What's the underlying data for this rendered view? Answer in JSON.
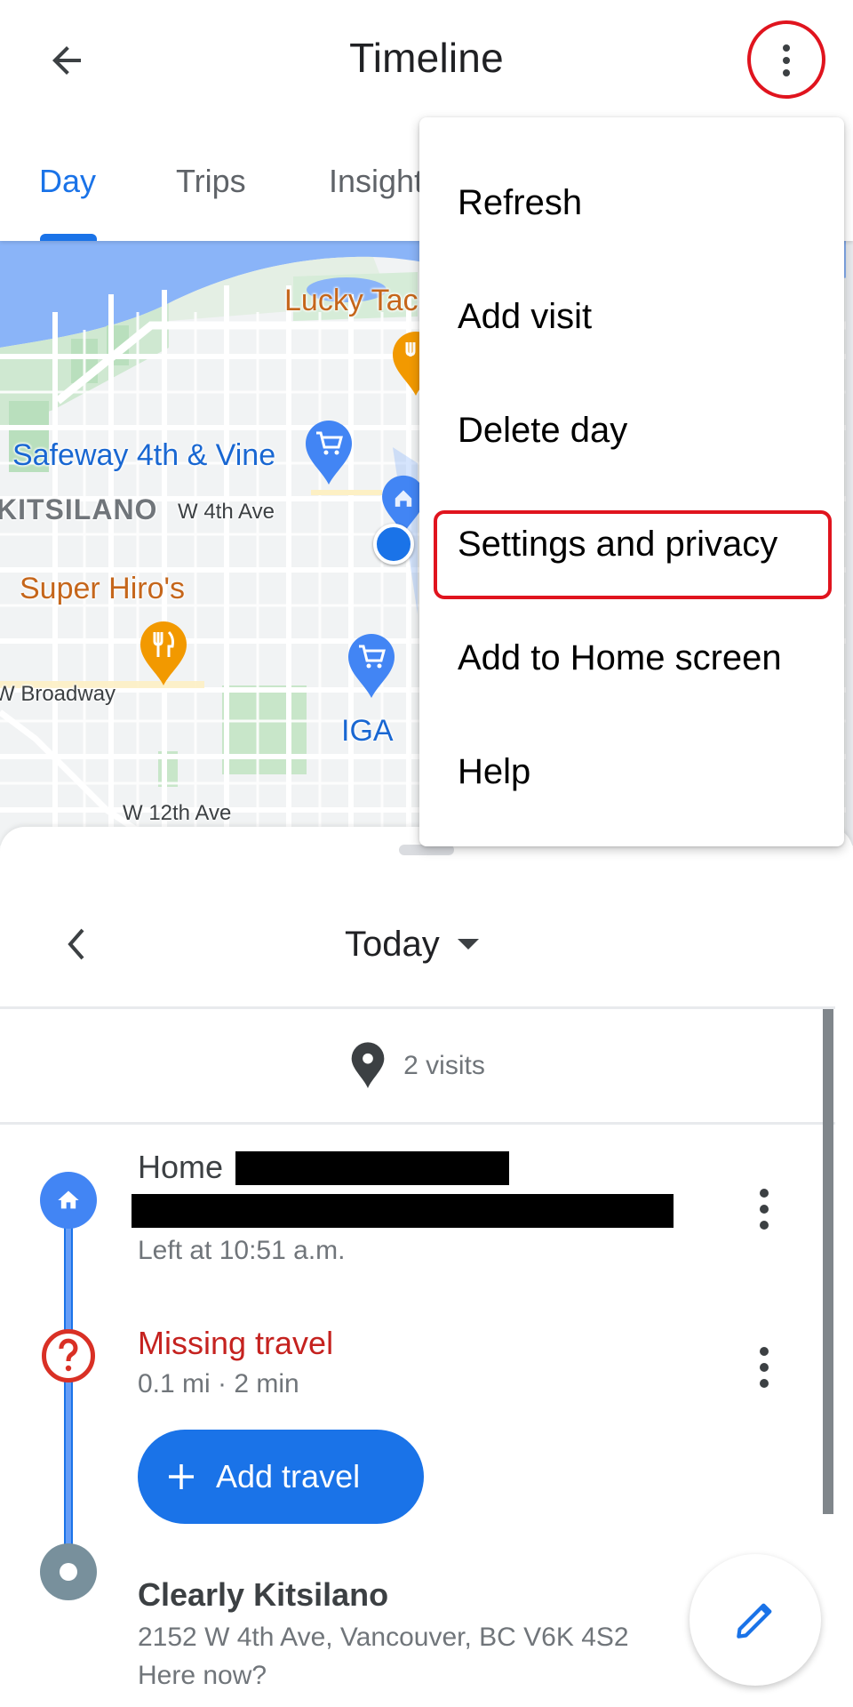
{
  "app_bar": {
    "title": "Timeline",
    "back_icon": "arrow-back-icon",
    "more_icon": "more-vert-icon"
  },
  "tabs": [
    {
      "label": "Day",
      "active": true
    },
    {
      "label": "Trips",
      "active": false
    },
    {
      "label": "Insights",
      "active": false
    }
  ],
  "map": {
    "labels": {
      "lucky": "Lucky Taco",
      "safeway": "Safeway 4th & Vine",
      "neighborhood": "KITSILANO",
      "w4th": "W 4th Ave",
      "superhiro": "Super Hiro's",
      "broadway": "W Broadway",
      "iga": "IGA",
      "w12th": "W 12th Ave"
    },
    "colors": {
      "water": "#8ab4f8",
      "park": "#c8e6c9",
      "restaurant_pin": "#f29900",
      "shop_pin": "#4285f4",
      "location_dot": "#1a73e8"
    }
  },
  "overflow_menu": {
    "items": [
      {
        "label": "Refresh"
      },
      {
        "label": "Add visit"
      },
      {
        "label": "Delete day"
      },
      {
        "label": "Settings and privacy",
        "highlighted": true
      },
      {
        "label": "Add to Home screen"
      },
      {
        "label": "Help"
      }
    ]
  },
  "day_nav": {
    "selected_day": "Today",
    "prev_icon": "chevron-left-icon"
  },
  "summary": {
    "visits_text": "2 visits"
  },
  "timeline": {
    "home": {
      "title": "Home",
      "left_text": "Left at 10:51 a.m."
    },
    "missing": {
      "title": "Missing travel",
      "detail": "0.1 mi · 2 min",
      "action_label": "Add travel"
    },
    "clearly": {
      "title": "Clearly Kitsilano",
      "address": "2152 W 4th Ave, Vancouver, BC V6K 4S2",
      "prompt": "Here now?"
    }
  },
  "colors": {
    "accent": "#1a73e8",
    "error": "#c5221f",
    "annotation": "#e0141e"
  }
}
